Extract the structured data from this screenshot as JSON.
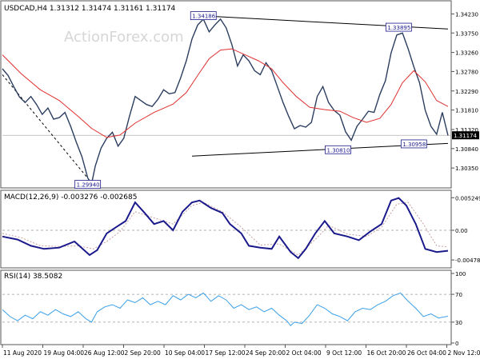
{
  "chart_data": {
    "type": "line",
    "symbol": "USDCAD,H4",
    "header": "USDCAD,H4  1.31312 1.31474 1.31161 1.31174",
    "watermark": "ActionForex.com",
    "x_labels": [
      "11 Aug 2020",
      "19 Aug 04:00",
      "26 Aug 12:00",
      "2 Sep 20:00",
      "10 Sep 04:00",
      "17 Sep 12:00",
      "24 Sep 20:00",
      "2 Oct 04:00",
      "9 Oct 12:00",
      "16 Oct 20:00",
      "26 Oct 04:00",
      "2 Nov 12:00"
    ],
    "price_panel": {
      "y_ticks": [
        1.3035,
        1.3084,
        1.3132,
        1.3181,
        1.3229,
        1.3278,
        1.3326,
        1.3375,
        1.3423
      ],
      "y_tick_labels": [
        "1.30350",
        "1.30840",
        "1.31320",
        "1.31810",
        "1.32290",
        "1.32780",
        "1.33260",
        "1.33750",
        "1.34230"
      ],
      "ylim": [
        1.2991,
        1.3448
      ],
      "current_price": 1.31174,
      "current_price_label": "1.31174",
      "close_path": [
        [
          0,
          1.3285
        ],
        [
          3,
          1.3268
        ],
        [
          6,
          1.324
        ],
        [
          9,
          1.3214
        ],
        [
          12,
          1.32
        ],
        [
          15,
          1.3215
        ],
        [
          18,
          1.3195
        ],
        [
          21,
          1.317
        ],
        [
          24,
          1.3186
        ],
        [
          27,
          1.3158
        ],
        [
          30,
          1.3162
        ],
        [
          33,
          1.3175
        ],
        [
          36,
          1.314
        ],
        [
          39,
          1.31
        ],
        [
          42,
          1.3063
        ],
        [
          45,
          1.301
        ],
        [
          47,
          1.2995
        ],
        [
          49,
          1.304
        ],
        [
          52,
          1.3085
        ],
        [
          55,
          1.311
        ],
        [
          58,
          1.3125
        ],
        [
          61,
          1.309
        ],
        [
          64,
          1.311
        ],
        [
          67,
          1.3165
        ],
        [
          70,
          1.3215
        ],
        [
          73,
          1.3205
        ],
        [
          76,
          1.3195
        ],
        [
          79,
          1.319
        ],
        [
          82,
          1.3208
        ],
        [
          85,
          1.3232
        ],
        [
          88,
          1.3222
        ],
        [
          91,
          1.3225
        ],
        [
          94,
          1.3262
        ],
        [
          97,
          1.3305
        ],
        [
          100,
          1.336
        ],
        [
          103,
          1.3395
        ],
        [
          106,
          1.341
        ],
        [
          109,
          1.3378
        ],
        [
          112,
          1.3395
        ],
        [
          115,
          1.341
        ],
        [
          118,
          1.3388
        ],
        [
          121,
          1.3346
        ],
        [
          124,
          1.3292
        ],
        [
          127,
          1.332
        ],
        [
          130,
          1.3305
        ],
        [
          133,
          1.328
        ],
        [
          136,
          1.327
        ],
        [
          139,
          1.33
        ],
        [
          142,
          1.328
        ],
        [
          145,
          1.324
        ],
        [
          148,
          1.32
        ],
        [
          151,
          1.3165
        ],
        [
          154,
          1.3134
        ],
        [
          157,
          1.3142
        ],
        [
          160,
          1.3138
        ],
        [
          163,
          1.315
        ],
        [
          166,
          1.3215
        ],
        [
          169,
          1.324
        ],
        [
          172,
          1.32
        ],
        [
          175,
          1.318
        ],
        [
          178,
          1.3168
        ],
        [
          181,
          1.3126
        ],
        [
          184,
          1.3105
        ],
        [
          187,
          1.314
        ],
        [
          190,
          1.3158
        ],
        [
          193,
          1.3178
        ],
        [
          196,
          1.3175
        ],
        [
          199,
          1.322
        ],
        [
          202,
          1.3255
        ],
        [
          205,
          1.3325
        ],
        [
          208,
          1.337
        ],
        [
          211,
          1.3375
        ],
        [
          214,
          1.3335
        ],
        [
          217,
          1.329
        ],
        [
          220,
          1.325
        ],
        [
          223,
          1.318
        ],
        [
          226,
          1.314
        ],
        [
          229,
          1.312
        ],
        [
          232,
          1.3175
        ],
        [
          235,
          1.3117
        ]
      ],
      "ma_path": [
        [
          0,
          1.332
        ],
        [
          10,
          1.3272
        ],
        [
          20,
          1.3232
        ],
        [
          30,
          1.3205
        ],
        [
          40,
          1.3165
        ],
        [
          47,
          1.3135
        ],
        [
          55,
          1.3112
        ],
        [
          62,
          1.3118
        ],
        [
          70,
          1.3148
        ],
        [
          80,
          1.3175
        ],
        [
          90,
          1.3196
        ],
        [
          97,
          1.3225
        ],
        [
          103,
          1.3268
        ],
        [
          109,
          1.331
        ],
        [
          115,
          1.3332
        ],
        [
          121,
          1.3335
        ],
        [
          128,
          1.332
        ],
        [
          135,
          1.3305
        ],
        [
          142,
          1.3285
        ],
        [
          148,
          1.325
        ],
        [
          155,
          1.3215
        ],
        [
          162,
          1.3188
        ],
        [
          170,
          1.3182
        ],
        [
          178,
          1.3178
        ],
        [
          185,
          1.3162
        ],
        [
          192,
          1.315
        ],
        [
          199,
          1.316
        ],
        [
          205,
          1.3195
        ],
        [
          211,
          1.325
        ],
        [
          217,
          1.328
        ],
        [
          223,
          1.3252
        ],
        [
          229,
          1.3205
        ],
        [
          235,
          1.319
        ]
      ],
      "upper_trendline": [
        [
          106,
          1.3418
        ],
        [
          235,
          1.3385
        ]
      ],
      "lower_trendline": [
        [
          100,
          1.3065
        ],
        [
          235,
          1.3097
        ]
      ],
      "downtrend_line": [
        [
          0,
          1.327
        ],
        [
          47,
          1.2998
        ]
      ],
      "annotations": [
        {
          "label": "1.34186",
          "x": 106,
          "y": 1.34186
        },
        {
          "label": "1.33895",
          "x": 209,
          "y": 1.33895
        },
        {
          "label": "1.30810",
          "x": 177,
          "y": 1.3081
        },
        {
          "label": "1.30958",
          "x": 217,
          "y": 1.30958
        },
        {
          "label": "1.29940",
          "x": 45,
          "y": 1.2994
        }
      ],
      "colors": {
        "price": "#2c3e60",
        "ma": "#e03030",
        "trendline": "#000000"
      }
    },
    "macd_panel": {
      "label": "MACD(12,26,9) -0.003276 -0.002685",
      "y_tick_labels": [
        "0.005249",
        "0.00",
        "-0.004785"
      ],
      "y_ticks": [
        0.005249,
        0.0,
        -0.004785
      ],
      "ylim": [
        -0.0058,
        0.0058
      ],
      "macd_path": [
        [
          0,
          -0.001
        ],
        [
          8,
          -0.0015
        ],
        [
          15,
          -0.0025
        ],
        [
          22,
          -0.003
        ],
        [
          30,
          -0.0028
        ],
        [
          38,
          -0.0018
        ],
        [
          46,
          -0.004
        ],
        [
          50,
          -0.0032
        ],
        [
          55,
          -0.0005
        ],
        [
          60,
          0.0005
        ],
        [
          65,
          0.0015
        ],
        [
          70,
          0.0045
        ],
        [
          75,
          0.0028
        ],
        [
          80,
          0.001
        ],
        [
          85,
          0.0015
        ],
        [
          90,
          0.0
        ],
        [
          95,
          0.003
        ],
        [
          100,
          0.0045
        ],
        [
          104,
          0.0048
        ],
        [
          110,
          0.0036
        ],
        [
          116,
          0.0028
        ],
        [
          120,
          0.001
        ],
        [
          126,
          -0.0005
        ],
        [
          130,
          -0.0025
        ],
        [
          136,
          -0.0028
        ],
        [
          142,
          -0.003
        ],
        [
          146,
          -0.001
        ],
        [
          152,
          -0.0035
        ],
        [
          156,
          -0.0045
        ],
        [
          160,
          -0.003
        ],
        [
          165,
          -0.0005
        ],
        [
          170,
          0.0015
        ],
        [
          175,
          -0.0005
        ],
        [
          182,
          -0.001
        ],
        [
          188,
          -0.0016
        ],
        [
          194,
          -0.0002
        ],
        [
          200,
          0.001
        ],
        [
          205,
          0.0048
        ],
        [
          209,
          0.0052
        ],
        [
          213,
          0.004
        ],
        [
          218,
          0.001
        ],
        [
          223,
          -0.003
        ],
        [
          229,
          -0.0035
        ],
        [
          235,
          -0.0033
        ]
      ],
      "signal_path": [
        [
          0,
          -0.0005
        ],
        [
          10,
          -0.0012
        ],
        [
          20,
          -0.0025
        ],
        [
          30,
          -0.0026
        ],
        [
          40,
          -0.0025
        ],
        [
          48,
          -0.003
        ],
        [
          55,
          -0.0018
        ],
        [
          62,
          -0.0002
        ],
        [
          70,
          0.003
        ],
        [
          80,
          0.002
        ],
        [
          90,
          0.001
        ],
        [
          100,
          0.004
        ],
        [
          106,
          0.0045
        ],
        [
          116,
          0.003
        ],
        [
          126,
          0.0005
        ],
        [
          136,
          -0.0024
        ],
        [
          146,
          -0.0022
        ],
        [
          156,
          -0.004
        ],
        [
          166,
          -0.0012
        ],
        [
          172,
          0.0008
        ],
        [
          182,
          -0.0006
        ],
        [
          192,
          -0.001
        ],
        [
          200,
          0.0005
        ],
        [
          208,
          0.0042
        ],
        [
          214,
          0.0045
        ],
        [
          222,
          0.001
        ],
        [
          229,
          -0.0025
        ],
        [
          235,
          -0.0027
        ]
      ],
      "colors": {
        "macd": "#1a1a8c",
        "signal": "#c8a0a0"
      }
    },
    "rsi_panel": {
      "label": "RSI(14) 38.5082",
      "y_tick_labels": [
        "100",
        "70",
        "30",
        "0"
      ],
      "y_ticks": [
        100,
        70,
        30,
        0
      ],
      "ylim": [
        0,
        100
      ],
      "rsi_path": [
        [
          0,
          48
        ],
        [
          4,
          38
        ],
        [
          8,
          32
        ],
        [
          12,
          40
        ],
        [
          16,
          35
        ],
        [
          20,
          45
        ],
        [
          24,
          40
        ],
        [
          28,
          48
        ],
        [
          32,
          42
        ],
        [
          36,
          38
        ],
        [
          40,
          45
        ],
        [
          44,
          35
        ],
        [
          47,
          30
        ],
        [
          50,
          45
        ],
        [
          54,
          52
        ],
        [
          58,
          55
        ],
        [
          62,
          50
        ],
        [
          66,
          62
        ],
        [
          70,
          58
        ],
        [
          74,
          65
        ],
        [
          78,
          55
        ],
        [
          82,
          60
        ],
        [
          86,
          55
        ],
        [
          90,
          68
        ],
        [
          94,
          62
        ],
        [
          98,
          70
        ],
        [
          102,
          65
        ],
        [
          106,
          72
        ],
        [
          110,
          60
        ],
        [
          114,
          68
        ],
        [
          118,
          62
        ],
        [
          122,
          50
        ],
        [
          126,
          55
        ],
        [
          130,
          48
        ],
        [
          134,
          52
        ],
        [
          138,
          45
        ],
        [
          142,
          50
        ],
        [
          146,
          40
        ],
        [
          150,
          32
        ],
        [
          152,
          25
        ],
        [
          154,
          30
        ],
        [
          158,
          28
        ],
        [
          162,
          40
        ],
        [
          166,
          55
        ],
        [
          170,
          50
        ],
        [
          174,
          42
        ],
        [
          178,
          38
        ],
        [
          182,
          32
        ],
        [
          186,
          45
        ],
        [
          190,
          50
        ],
        [
          194,
          48
        ],
        [
          198,
          55
        ],
        [
          202,
          60
        ],
        [
          206,
          68
        ],
        [
          210,
          72
        ],
        [
          214,
          60
        ],
        [
          218,
          50
        ],
        [
          222,
          38
        ],
        [
          226,
          42
        ],
        [
          230,
          36
        ],
        [
          235,
          38.5
        ]
      ],
      "colors": {
        "rsi": "#3aa0e8"
      }
    }
  }
}
